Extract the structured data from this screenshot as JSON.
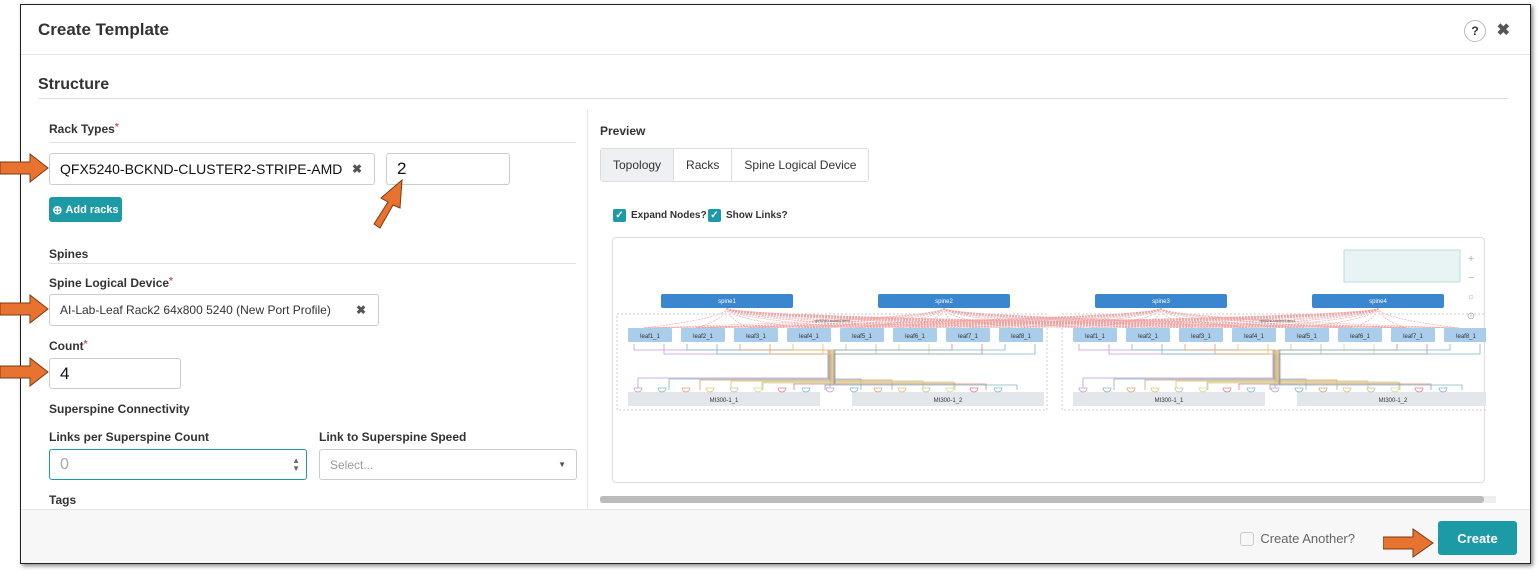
{
  "dialog": {
    "title": "Create Template",
    "help": "?",
    "close": "✖"
  },
  "structure": {
    "heading": "Structure"
  },
  "rack_types": {
    "label": "Rack Types",
    "required": "*",
    "value": "QFX5240-BCKND-CLUSTER2-STRIPE-AMD",
    "clear": "✖",
    "count": "2",
    "add_label": "Add racks",
    "add_icon": "⊕"
  },
  "spines": {
    "heading": "Spines",
    "device_label": "Spine Logical Device",
    "device_value": "AI-Lab-Leaf Rack2 64x800 5240 (New Port Profile)",
    "count_label": "Count",
    "count_value": "4"
  },
  "superspine": {
    "heading": "Superspine Connectivity",
    "links_label": "Links per Superspine Count",
    "links_placeholder": "0",
    "speed_label": "Link to Superspine Speed",
    "speed_placeholder": "Select..."
  },
  "tags": {
    "label": "Tags"
  },
  "preview": {
    "heading": "Preview",
    "tabs": [
      "Topology",
      "Racks",
      "Spine Logical Device"
    ],
    "expand_nodes": "Expand Nodes?",
    "show_links": "Show Links?"
  },
  "topology": {
    "spines": [
      "spine1",
      "spine2",
      "spine3",
      "spine4"
    ],
    "rack_label": "qfx5240-bcknd-amd",
    "leaves": [
      "leaf1_1",
      "leaf2_1",
      "leaf3_1",
      "leaf4_1",
      "leaf5_1",
      "leaf6_1",
      "leaf7_1",
      "leaf8_1"
    ],
    "servers": [
      "MI300-1_1",
      "MI300-1_2"
    ],
    "link_colors": [
      "#c59ad6",
      "#7fb6c4",
      "#e0a070",
      "#e8c070",
      "#b8c890",
      "#d8d890",
      "#e08080",
      "#7fb6c4"
    ]
  },
  "footer": {
    "create_another": "Create Another?",
    "create": "Create"
  },
  "colors": {
    "accent": "#1c9aa6",
    "spine": "#3a87d0",
    "leaf": "#a9cdea",
    "arrow": "#e87330"
  }
}
